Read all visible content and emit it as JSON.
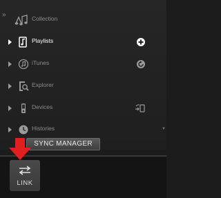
{
  "sidebar": {
    "collapse_glyph": "»",
    "items": [
      {
        "label": "Collection",
        "icon": "music-notes-icon",
        "active": false
      },
      {
        "label": "Playlists",
        "icon": "playlist-icon",
        "active": true,
        "action_icon": "add-icon"
      },
      {
        "label": "iTunes",
        "icon": "itunes-icon",
        "active": false,
        "action_icon": "refresh-icon"
      },
      {
        "label": "Explorer",
        "icon": "folder-search-icon",
        "active": false
      },
      {
        "label": "Devices",
        "icon": "device-icon",
        "active": false,
        "action_icon": "sync-device-icon"
      },
      {
        "label": "Histories",
        "icon": "clock-icon",
        "active": false
      }
    ],
    "scroll_glyph": "▼"
  },
  "sync_button": {
    "label": "SYNC MANAGER"
  },
  "link_button": {
    "label": "LINK",
    "icon": "link-arrows-icon"
  },
  "annotation": {
    "icon": "red-down-arrow-icon",
    "color": "#e02020"
  }
}
